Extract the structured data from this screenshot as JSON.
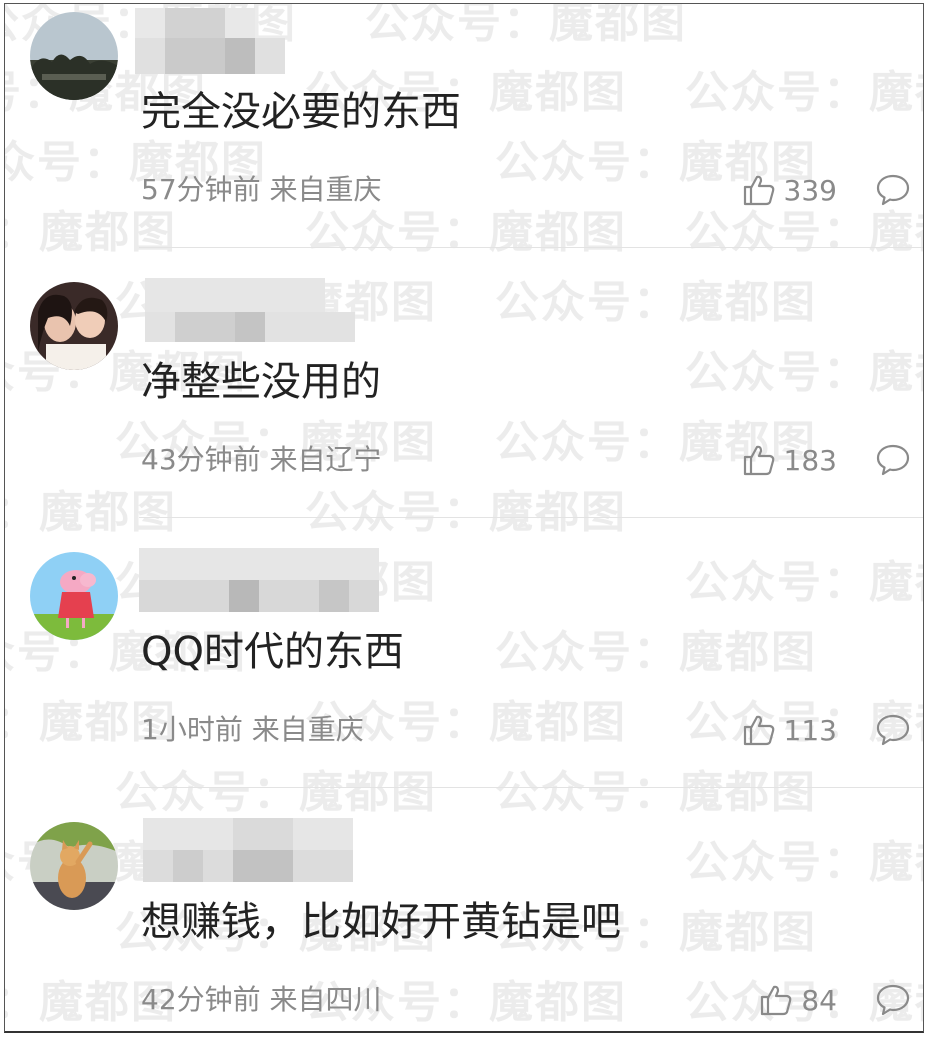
{
  "watermark": "公众号：魔都图",
  "comments": [
    {
      "text": "完全没必要的东西",
      "time": "57分钟前",
      "location": "来自重庆",
      "likes": "339",
      "avatar": "landscape-avatar"
    },
    {
      "text": "净整些没用的",
      "time": "43分钟前",
      "location": "来自辽宁",
      "likes": "183",
      "avatar": "couple-photo-avatar"
    },
    {
      "text": "QQ时代的东西",
      "time": "1小时前",
      "location": "来自重庆",
      "likes": "113",
      "avatar": "peppa-pig-avatar"
    },
    {
      "text": "想赚钱，比如好开黄钻是吧",
      "time": "42分钟前",
      "location": "来自四川",
      "likes": "84",
      "avatar": "cat-avatar"
    }
  ],
  "icons": {
    "like": "thumbs-up-icon",
    "reply": "comment-bubble-icon"
  },
  "colors": {
    "text": "#222222",
    "meta": "#8a8a8a",
    "divider": "#e3e3e3"
  }
}
